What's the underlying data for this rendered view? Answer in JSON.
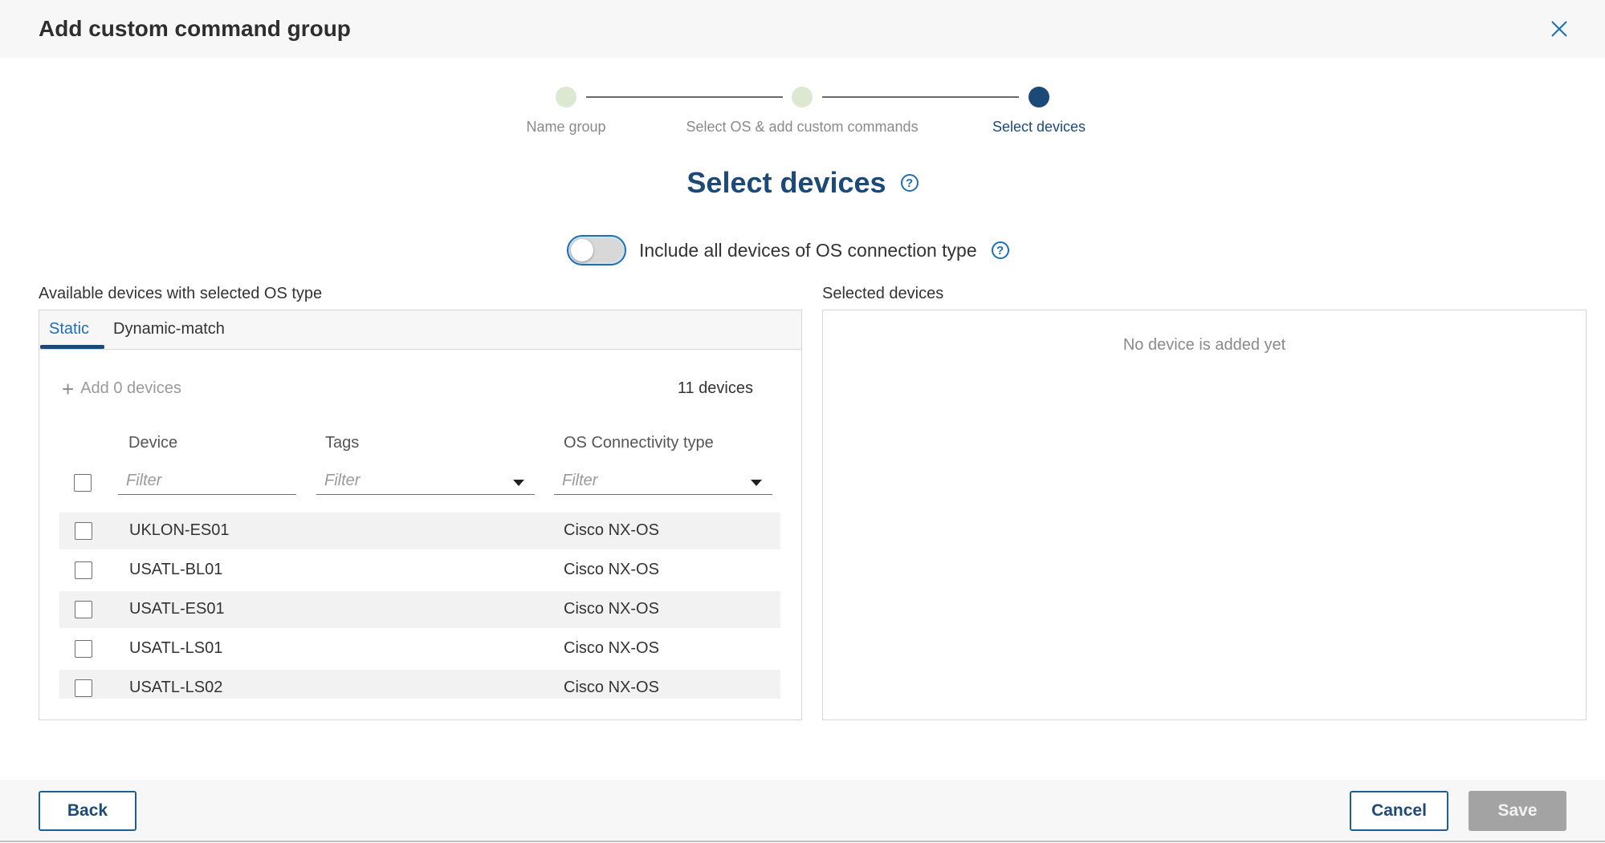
{
  "dialog": {
    "title": "Add custom command group"
  },
  "stepper": {
    "steps": [
      {
        "label": "Name group",
        "state": "completed"
      },
      {
        "label": "Select OS & add custom commands",
        "state": "completed"
      },
      {
        "label": "Select devices",
        "state": "active"
      }
    ]
  },
  "section": {
    "title": "Select devices",
    "help_glyph": "?"
  },
  "toggle": {
    "label": "Include all devices of OS connection type",
    "checked": false
  },
  "available": {
    "label": "Available devices with selected OS type",
    "tabs": [
      {
        "label": "Static",
        "active": true
      },
      {
        "label": "Dynamic-match",
        "active": false
      }
    ],
    "add_label": "Add 0 devices",
    "count_label": "11 devices",
    "columns": {
      "device": "Device",
      "tags": "Tags",
      "os": "OS Connectivity type"
    },
    "filter_placeholder": "Filter",
    "rows": [
      {
        "device": "UKLON-ES01",
        "tags": "",
        "os": "Cisco NX-OS"
      },
      {
        "device": "USATL-BL01",
        "tags": "",
        "os": "Cisco NX-OS"
      },
      {
        "device": "USATL-ES01",
        "tags": "",
        "os": "Cisco NX-OS"
      },
      {
        "device": "USATL-LS01",
        "tags": "",
        "os": "Cisco NX-OS"
      },
      {
        "device": "USATL-LS02",
        "tags": "",
        "os": "Cisco NX-OS"
      }
    ]
  },
  "selected": {
    "label": "Selected devices",
    "empty_message": "No device is added yet"
  },
  "footer": {
    "back_label": "Back",
    "cancel_label": "Cancel",
    "save_label": "Save"
  },
  "colors": {
    "primary": "#1c4a78",
    "accent": "#1e6fb3",
    "step_completed": "#dde8d2",
    "disabled": "#a3a3a3"
  },
  "icons": {
    "close": "close-icon",
    "help": "help-icon",
    "plus": "plus-icon",
    "caret": "caret-down-icon"
  }
}
